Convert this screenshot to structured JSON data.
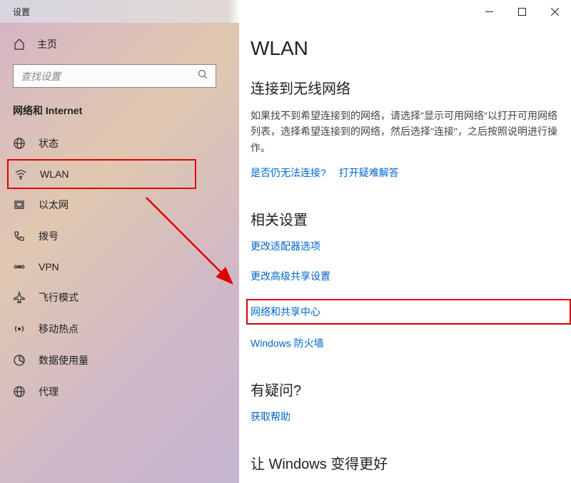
{
  "titlebar": {
    "title": "设置"
  },
  "sidebar": {
    "home": "主页",
    "search_placeholder": "查找设置",
    "section": "网络和 Internet",
    "items": [
      {
        "label": "状态"
      },
      {
        "label": "WLAN"
      },
      {
        "label": "以太网"
      },
      {
        "label": "拨号"
      },
      {
        "label": "VPN"
      },
      {
        "label": "飞行模式"
      },
      {
        "label": "移动热点"
      },
      {
        "label": "数据使用量"
      },
      {
        "label": "代理"
      }
    ]
  },
  "content": {
    "title": "WLAN",
    "connect_section": {
      "title": "连接到无线网络",
      "text": "如果找不到希望连接到的网络，请选择\"显示可用网络\"以打开可用网络列表，选择希望连接到的网络，然后选择\"连接\"，之后按照说明进行操作。",
      "link1": "是否仍无法连接?",
      "link2": "打开疑难解答"
    },
    "related": {
      "title": "相关设置",
      "links": [
        "更改适配器选项",
        "更改高级共享设置",
        "网络和共享中心",
        "Windows 防火墙"
      ]
    },
    "questions": {
      "title": "有疑问?",
      "link": "获取帮助"
    },
    "improve": {
      "title": "让 Windows 变得更好"
    }
  }
}
